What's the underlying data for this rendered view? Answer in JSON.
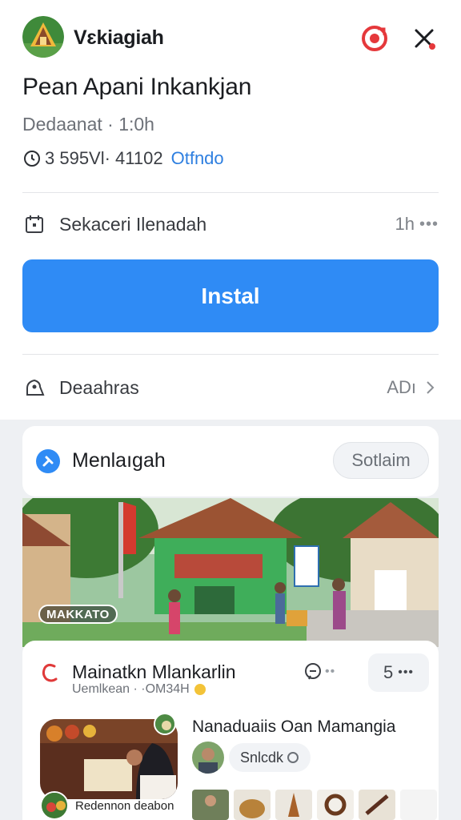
{
  "app": {
    "name": "Vɛkiagiah",
    "title": "Pean Apani Inkankjan",
    "subtitle": "Dedaanat · 1:0h",
    "meta_text": "3 595Vl· 41102",
    "meta_link": "Otfndo"
  },
  "rows": {
    "schedule_label": "Sekaceri Ilenadah",
    "schedule_value": "1h",
    "description_label": "Deaahras",
    "description_value": "ADı"
  },
  "install_label": "Instal",
  "section": {
    "title": "Menlaıgah",
    "button": "Sotlaim"
  },
  "hero_caption": "MAKKATO",
  "post": {
    "title": "Mainatkn Mlankarlin",
    "subtitle": "Uemlkean · ·OM34H",
    "count": "5",
    "side_title": "Nanaduaiis Oan Mamangia",
    "chip_label": "Snlcdk",
    "thumb_caption": "Redennon deabon"
  },
  "icons": {
    "share": "share-icon",
    "close": "close-icon",
    "clock": "clock-icon",
    "calendar": "calendar-icon",
    "info": "info-icon",
    "chevron": "chevron-right-icon"
  },
  "colors": {
    "accent": "#2f8bf5",
    "link": "#2e7fe0",
    "share_red": "#e5383b"
  }
}
